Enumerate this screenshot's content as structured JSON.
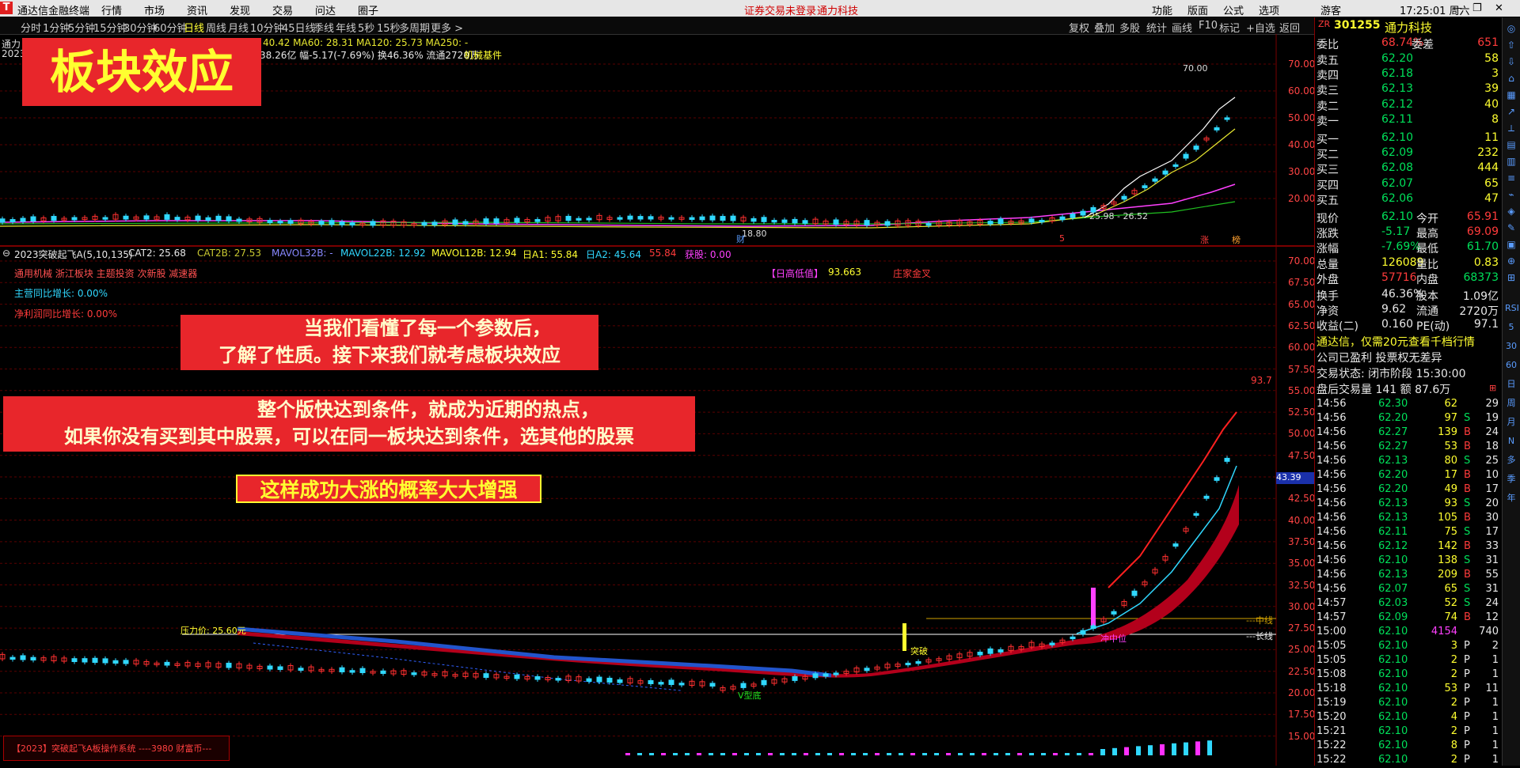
{
  "titlebar": {
    "app_name": "通达信金融终端",
    "menus": [
      "行情",
      "市场",
      "资讯",
      "发现",
      "交易",
      "问达",
      "圈子"
    ],
    "notice": "证券交易未登录",
    "stock_title": "通力科技",
    "right_menus": [
      "功能",
      "版面",
      "公式",
      "选项"
    ],
    "user": "游客",
    "clock": "17:25:01 周六"
  },
  "periods": [
    "分时",
    "1分钟",
    "5分钟",
    "15分钟",
    "30分钟",
    "60分钟",
    "日线",
    "周线",
    "月线",
    "10分钟",
    "45日线",
    "季线",
    "年线",
    "5秒",
    "15秒",
    "多周期",
    "更多 >"
  ],
  "active_period": "日线",
  "right_tools": [
    "复权",
    "叠加",
    "多股",
    "统计",
    "画线",
    "F10",
    "标记",
    "+自选",
    "返回"
  ],
  "upper_pane": {
    "ma_line": "40.42  MA60: 28.31  MA120: 25.73  MA250: -",
    "info_line": "38.26亿 幅-5.17(-7.69%) 换46.36% 流通2720万",
    "sector_tag": "机械基件",
    "stock_prefix": "通力",
    "year_prefix": "2023",
    "high_label": "70.00",
    "low_label": "18.80",
    "price_label": "25.98 - 26.52",
    "markers": [
      "财",
      "5",
      "涨",
      "榜"
    ],
    "axis": [
      "70.00",
      "60.00",
      "50.00",
      "40.00",
      "30.00",
      "20.00"
    ]
  },
  "lower_pane": {
    "indicator_title": "2023突破起飞A(5,10,135)",
    "indicator_values": [
      {
        "text": "CAT2: 25.68",
        "color": "#e8e8e8"
      },
      {
        "text": "CAT2B: 27.53",
        "color": "#c8c830"
      },
      {
        "text": "MAVOL32B: -",
        "color": "#8888ff"
      },
      {
        "text": "MAVOL22B: 12.92",
        "color": "#30d8ff"
      },
      {
        "text": "MAVOL12B: 12.94",
        "color": "#ffff30"
      },
      {
        "text": "日A1: 55.84",
        "color": "#ffff30"
      },
      {
        "text": "日A2: 45.64",
        "color": "#30d8ff"
      },
      {
        "text": "55.84",
        "color": "#ff3b3b"
      },
      {
        "text": "获股: 0.00",
        "color": "#ff40ff"
      }
    ],
    "tags_line": "通用机械 浙江板块 主题投资 次新股 减速器",
    "main_growth": "主营同比增长: 0.00%",
    "profit_growth": "净利润同比增长: 0.00%",
    "high_low_label": "【日高低值】",
    "high_low_value": "93.663",
    "zhuang_label": "庄家金叉",
    "side_value": "93.7",
    "current_tag": "43.39",
    "pressure_label": "压力价: 25.60元",
    "v_bottom": "V型底",
    "breakout": "突破",
    "mid_level": "冲中位",
    "mid_right": "---中线",
    "long_right": "---长线",
    "axis": [
      "70.00",
      "67.50",
      "65.00",
      "62.50",
      "60.00",
      "57.50",
      "55.00",
      "52.50",
      "50.00",
      "47.50",
      "45.00",
      "42.50",
      "40.00",
      "37.50",
      "35.00",
      "32.50",
      "30.00",
      "27.50",
      "25.00",
      "22.50",
      "20.00",
      "17.50",
      "15.00"
    ],
    "footer": "【2023】突破起飞A板操作系统 ----3980 财富币---"
  },
  "overlays": {
    "title": "板块效应",
    "text1_l1": "当我们看懂了每一个参数后，",
    "text1_l2": "了解了性质。接下来我们就考虑板块效应",
    "text2_l1": "整个版快达到条件，就成为近期的热点，",
    "text2_l2": "如果你没有买到其中股票，可以在同一板块达到条件，选其他的股票",
    "text3": "这样成功大涨的概率大大增强"
  },
  "side": {
    "code_prefix": "ZR",
    "code": "301255",
    "name": "通力科技",
    "weibi_label": "委比",
    "weibi": "68.74%",
    "weicha_label": "委差",
    "weicha": "651",
    "sells": [
      {
        "label": "卖五",
        "price": "62.20",
        "vol": "58"
      },
      {
        "label": "卖四",
        "price": "62.18",
        "vol": "3"
      },
      {
        "label": "卖三",
        "price": "62.13",
        "vol": "39"
      },
      {
        "label": "卖二",
        "price": "62.12",
        "vol": "40"
      },
      {
        "label": "卖一",
        "price": "62.11",
        "vol": "8"
      }
    ],
    "buys": [
      {
        "label": "买一",
        "price": "62.10",
        "vol": "11"
      },
      {
        "label": "买二",
        "price": "62.09",
        "vol": "232"
      },
      {
        "label": "买三",
        "price": "62.08",
        "vol": "444"
      },
      {
        "label": "买四",
        "price": "62.07",
        "vol": "65"
      },
      {
        "label": "买五",
        "price": "62.06",
        "vol": "47"
      }
    ],
    "stats": [
      {
        "l1": "现价",
        "v1": "62.10",
        "c1": "grn",
        "l2": "今开",
        "v2": "65.91",
        "c2": "red"
      },
      {
        "l1": "涨跌",
        "v1": "-5.17",
        "c1": "grn",
        "l2": "最高",
        "v2": "69.09",
        "c2": "red"
      },
      {
        "l1": "涨幅",
        "v1": "-7.69%",
        "c1": "grn",
        "l2": "最低",
        "v2": "61.70",
        "c2": "grn"
      },
      {
        "l1": "总量",
        "v1": "126089",
        "c1": "yel",
        "l2": "量比",
        "v2": "0.83",
        "c2": "yel"
      },
      {
        "l1": "外盘",
        "v1": "57716",
        "c1": "red",
        "l2": "内盘",
        "v2": "68373",
        "c2": "grn"
      }
    ],
    "stats2": [
      {
        "l1": "换手",
        "v1": "46.36%",
        "l2": "股本",
        "v2": "1.09亿"
      },
      {
        "l1": "净资",
        "v1": "9.62",
        "l2": "流通",
        "v2": "2720万"
      },
      {
        "l1": "收益(二)",
        "v1": "0.160",
        "l2": "PE(动)",
        "v2": "97.1"
      }
    ],
    "promo": "通达信，仅需20元查看千档行情",
    "info1": "公司已盈利 投票权无差异",
    "info2": "交易状态: 闭市阶段 15:30:00",
    "info3": "盘后交易量 141 额 87.6万",
    "ticks": [
      {
        "t": "14:56",
        "p": "62.30",
        "v": "62",
        "d": "",
        "n": "29"
      },
      {
        "t": "14:56",
        "p": "62.20",
        "v": "97",
        "d": "S",
        "n": "19"
      },
      {
        "t": "14:56",
        "p": "62.27",
        "v": "139",
        "d": "B",
        "n": "24"
      },
      {
        "t": "14:56",
        "p": "62.27",
        "v": "53",
        "d": "B",
        "n": "18"
      },
      {
        "t": "14:56",
        "p": "62.13",
        "v": "80",
        "d": "S",
        "n": "25"
      },
      {
        "t": "14:56",
        "p": "62.20",
        "v": "17",
        "d": "B",
        "n": "10"
      },
      {
        "t": "14:56",
        "p": "62.20",
        "v": "49",
        "d": "B",
        "n": "17"
      },
      {
        "t": "14:56",
        "p": "62.13",
        "v": "93",
        "d": "S",
        "n": "20"
      },
      {
        "t": "14:56",
        "p": "62.13",
        "v": "105",
        "d": "B",
        "n": "30"
      },
      {
        "t": "14:56",
        "p": "62.11",
        "v": "75",
        "d": "S",
        "n": "17"
      },
      {
        "t": "14:56",
        "p": "62.12",
        "v": "142",
        "d": "B",
        "n": "33"
      },
      {
        "t": "14:56",
        "p": "62.10",
        "v": "138",
        "d": "S",
        "n": "31"
      },
      {
        "t": "14:56",
        "p": "62.13",
        "v": "209",
        "d": "B",
        "n": "55"
      },
      {
        "t": "14:56",
        "p": "62.07",
        "v": "65",
        "d": "S",
        "n": "31"
      },
      {
        "t": "14:57",
        "p": "62.03",
        "v": "52",
        "d": "S",
        "n": "24"
      },
      {
        "t": "14:57",
        "p": "62.09",
        "v": "74",
        "d": "B",
        "n": "12"
      },
      {
        "t": "15:00",
        "p": "62.10",
        "v": "4154",
        "d": "",
        "n": "740"
      },
      {
        "t": "15:05",
        "p": "62.10",
        "v": "3",
        "d": "P",
        "n": "2"
      },
      {
        "t": "15:05",
        "p": "62.10",
        "v": "2",
        "d": "P",
        "n": "1"
      },
      {
        "t": "15:08",
        "p": "62.10",
        "v": "2",
        "d": "P",
        "n": "1"
      },
      {
        "t": "15:18",
        "p": "62.10",
        "v": "53",
        "d": "P",
        "n": "11"
      },
      {
        "t": "15:19",
        "p": "62.10",
        "v": "2",
        "d": "P",
        "n": "1"
      },
      {
        "t": "15:20",
        "p": "62.10",
        "v": "4",
        "d": "P",
        "n": "1"
      },
      {
        "t": "15:21",
        "p": "62.10",
        "v": "2",
        "d": "P",
        "n": "1"
      },
      {
        "t": "15:22",
        "p": "62.10",
        "v": "8",
        "d": "P",
        "n": "1"
      },
      {
        "t": "15:22",
        "p": "62.10",
        "v": "2",
        "d": "P",
        "n": "1"
      }
    ]
  },
  "toolstrip_labels": [
    "RSI",
    "5",
    "30",
    "60",
    "日",
    "周",
    "月",
    "N",
    "多",
    "季",
    "年"
  ]
}
